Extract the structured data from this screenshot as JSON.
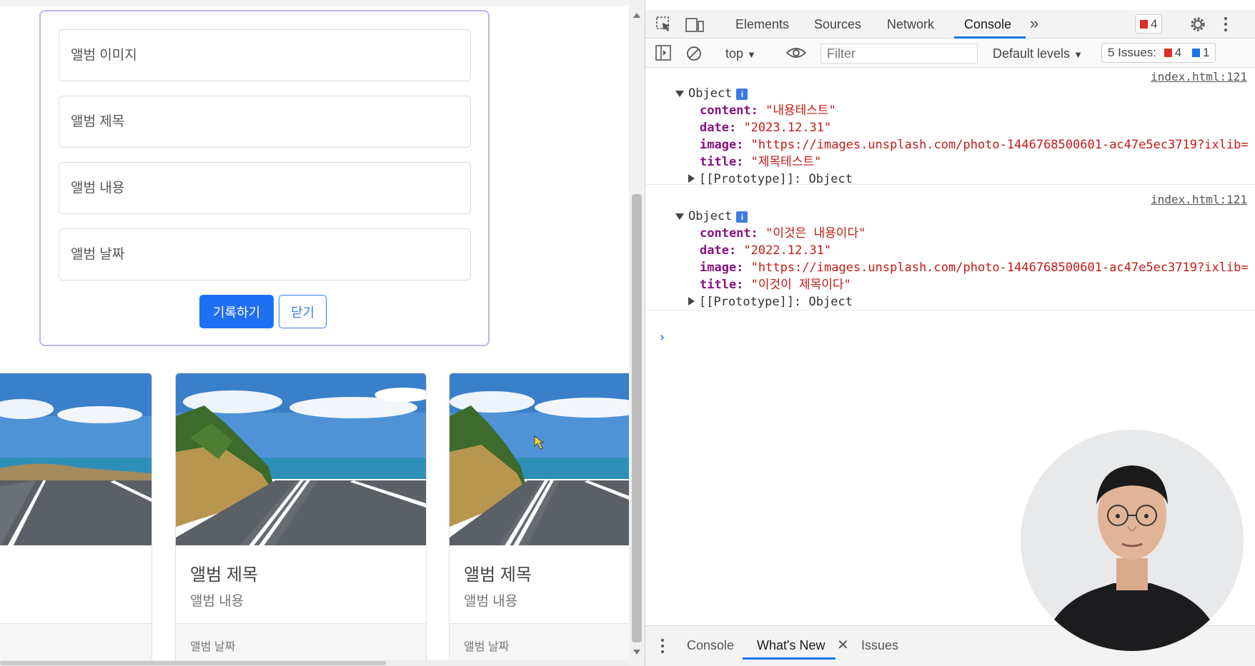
{
  "form": {
    "image_placeholder": "앨범 이미지",
    "title_placeholder": "앨범 제목",
    "content_placeholder": "앨범 내용",
    "date_placeholder": "앨범 날짜",
    "submit_label": "기록하기",
    "close_label": "닫기"
  },
  "album_cards": [
    {
      "title": "",
      "content": "",
      "date": ""
    },
    {
      "title": "앨범 제목",
      "content": "앨범 내용",
      "date": "앨범 날짜"
    },
    {
      "title": "앨범 제목",
      "content": "앨범 내용",
      "date": "앨범 날짜"
    }
  ],
  "devtools": {
    "tabs": [
      "Elements",
      "Sources",
      "Network",
      "Console"
    ],
    "active_tab": "Console",
    "more_tabs_icon": "»",
    "error_count": "4",
    "context": "top",
    "filter_placeholder": "Filter",
    "levels": "Default levels",
    "issues_label": "5 Issues:",
    "issues_errors": "4",
    "issues_info": "1",
    "logs": [
      {
        "source": "index.html:121",
        "label": "Object",
        "content": "\"내용테스트\"",
        "date": "\"2023.12.31\"",
        "image": "\"https://images.unsplash.com/photo-1446768500601-ac47e5ec3719?ixlib=",
        "title": "\"제목테스트\"",
        "prototype": "[[Prototype]]: Object"
      },
      {
        "source": "index.html:121",
        "label": "Object",
        "content": "\"이것은 내용이다\"",
        "date": "\"2022.12.31\"",
        "image": "\"https://images.unsplash.com/photo-1446768500601-ac47e5ec3719?ixlib=",
        "title": "\"이것이 제목이다\"",
        "prototype": "[[Prototype]]: Object"
      }
    ],
    "keys": {
      "content": "content:",
      "date": "date:",
      "image": "image:",
      "title": "title:"
    },
    "prompt": "›",
    "drawer_tabs": [
      "Console",
      "What's New",
      "Issues"
    ],
    "drawer_active": "What's New"
  },
  "colors": {
    "primary": "#1f6ff2",
    "form_border": "#b9b6f4",
    "devtools_accent": "#1a73e8",
    "string_value": "#c41a16",
    "object_key": "#881280"
  }
}
